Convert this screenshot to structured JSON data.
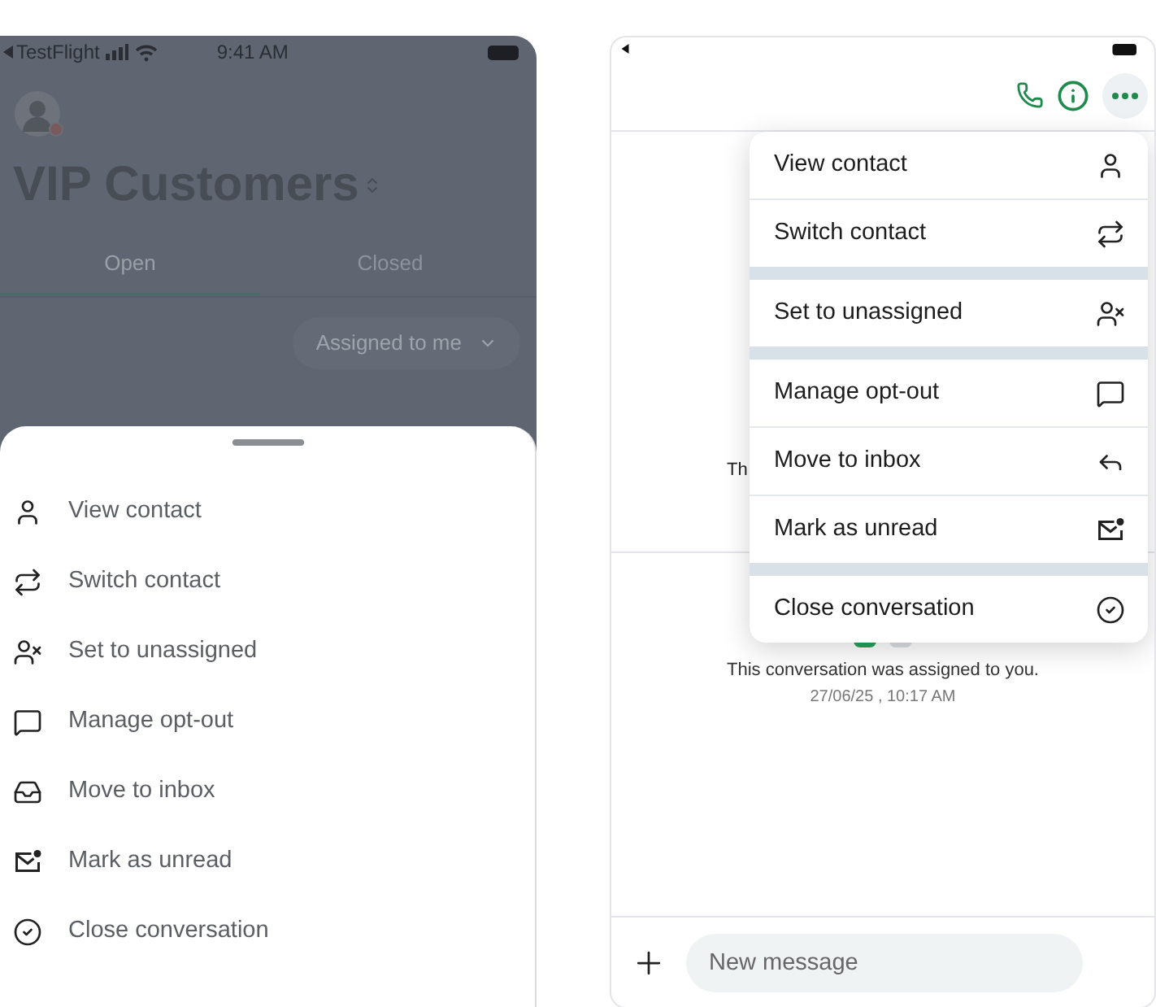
{
  "left_screen": {
    "status_bar": {
      "back_label": "TestFlight",
      "time": "9:41 AM"
    },
    "title": "VIP Customers",
    "tabs": [
      {
        "label": "Open",
        "selected": true
      },
      {
        "label": "Closed",
        "selected": false
      }
    ],
    "filter": "Assigned to me",
    "sheet": {
      "items": [
        {
          "kind": "contact",
          "label": "View contact"
        },
        {
          "kind": "switch",
          "label": "Switch contact"
        },
        {
          "kind": "unassign",
          "label": "Set to unassigned"
        },
        {
          "kind": "optout",
          "label": "Manage opt-out"
        },
        {
          "kind": "inbox",
          "label": "Move to inbox"
        },
        {
          "kind": "unread",
          "label": "Mark as unread"
        },
        {
          "kind": "close",
          "label": "Close conversation"
        }
      ]
    }
  },
  "right_screen": {
    "covered_text": "Th",
    "event": {
      "text": "This conversation was assigned to you.",
      "time": "27/06/25 , 10:17 AM"
    },
    "menu": {
      "groups": [
        [
          {
            "kind": "contact",
            "label": "View contact"
          },
          {
            "kind": "switch",
            "label": "Switch contact"
          }
        ],
        [
          {
            "kind": "unassign",
            "label": "Set to unassigned"
          }
        ],
        [
          {
            "kind": "optout",
            "label": "Manage opt-out"
          },
          {
            "kind": "reply",
            "label": "Move to inbox"
          },
          {
            "kind": "unread",
            "label": "Mark as unread"
          }
        ],
        [
          {
            "kind": "close",
            "label": "Close conversation"
          }
        ]
      ]
    },
    "composer": {
      "placeholder": "New message"
    }
  }
}
